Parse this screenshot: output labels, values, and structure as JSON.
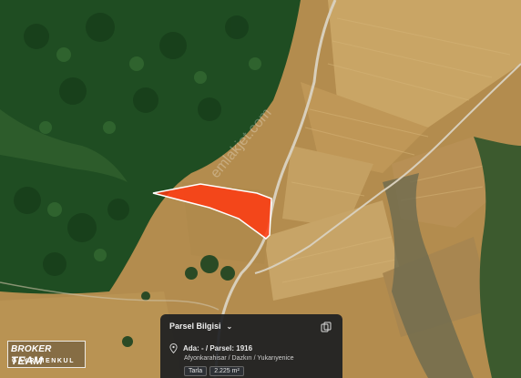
{
  "map": {
    "type": "satellite-parcel-view",
    "parcel_color": "#ff3a12",
    "forest_color": "#1f4d22",
    "field_color": "#b88f4a",
    "road_color": "#d8cfbc"
  },
  "watermark": "emlakjet.com",
  "parcel_card": {
    "title": "Parsel Bilgisi",
    "chevron_icon": "chevron-down-icon",
    "copy_icon": "copy-icon",
    "location_icon": "map-pin-icon",
    "ada_parsel": "Ada: - / Parsel: 1916",
    "location": "Afyonkarahisar / Dazkırı / Yukarıyenice",
    "type_badge": "Tarla",
    "area_badge": "2.225 m²"
  },
  "logo": {
    "line1_a": "BROKER",
    "line1_b": "TEAM",
    "line2": "GAYRİMENKUL"
  }
}
